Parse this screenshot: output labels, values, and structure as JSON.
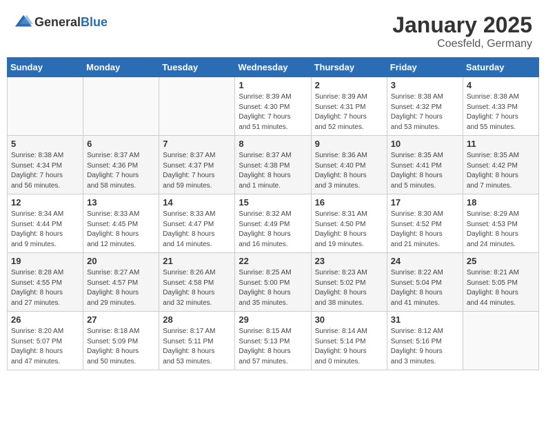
{
  "header": {
    "logo_general": "General",
    "logo_blue": "Blue",
    "title": "January 2025",
    "subtitle": "Coesfeld, Germany"
  },
  "weekdays": [
    "Sunday",
    "Monday",
    "Tuesday",
    "Wednesday",
    "Thursday",
    "Friday",
    "Saturday"
  ],
  "weeks": [
    [
      {
        "day": "",
        "info": ""
      },
      {
        "day": "",
        "info": ""
      },
      {
        "day": "",
        "info": ""
      },
      {
        "day": "1",
        "info": "Sunrise: 8:39 AM\nSunset: 4:30 PM\nDaylight: 7 hours\nand 51 minutes."
      },
      {
        "day": "2",
        "info": "Sunrise: 8:39 AM\nSunset: 4:31 PM\nDaylight: 7 hours\nand 52 minutes."
      },
      {
        "day": "3",
        "info": "Sunrise: 8:38 AM\nSunset: 4:32 PM\nDaylight: 7 hours\nand 53 minutes."
      },
      {
        "day": "4",
        "info": "Sunrise: 8:38 AM\nSunset: 4:33 PM\nDaylight: 7 hours\nand 55 minutes."
      }
    ],
    [
      {
        "day": "5",
        "info": "Sunrise: 8:38 AM\nSunset: 4:34 PM\nDaylight: 7 hours\nand 56 minutes."
      },
      {
        "day": "6",
        "info": "Sunrise: 8:37 AM\nSunset: 4:36 PM\nDaylight: 7 hours\nand 58 minutes."
      },
      {
        "day": "7",
        "info": "Sunrise: 8:37 AM\nSunset: 4:37 PM\nDaylight: 7 hours\nand 59 minutes."
      },
      {
        "day": "8",
        "info": "Sunrise: 8:37 AM\nSunset: 4:38 PM\nDaylight: 8 hours\nand 1 minute."
      },
      {
        "day": "9",
        "info": "Sunrise: 8:36 AM\nSunset: 4:40 PM\nDaylight: 8 hours\nand 3 minutes."
      },
      {
        "day": "10",
        "info": "Sunrise: 8:35 AM\nSunset: 4:41 PM\nDaylight: 8 hours\nand 5 minutes."
      },
      {
        "day": "11",
        "info": "Sunrise: 8:35 AM\nSunset: 4:42 PM\nDaylight: 8 hours\nand 7 minutes."
      }
    ],
    [
      {
        "day": "12",
        "info": "Sunrise: 8:34 AM\nSunset: 4:44 PM\nDaylight: 8 hours\nand 9 minutes."
      },
      {
        "day": "13",
        "info": "Sunrise: 8:33 AM\nSunset: 4:45 PM\nDaylight: 8 hours\nand 12 minutes."
      },
      {
        "day": "14",
        "info": "Sunrise: 8:33 AM\nSunset: 4:47 PM\nDaylight: 8 hours\nand 14 minutes."
      },
      {
        "day": "15",
        "info": "Sunrise: 8:32 AM\nSunset: 4:49 PM\nDaylight: 8 hours\nand 16 minutes."
      },
      {
        "day": "16",
        "info": "Sunrise: 8:31 AM\nSunset: 4:50 PM\nDaylight: 8 hours\nand 19 minutes."
      },
      {
        "day": "17",
        "info": "Sunrise: 8:30 AM\nSunset: 4:52 PM\nDaylight: 8 hours\nand 21 minutes."
      },
      {
        "day": "18",
        "info": "Sunrise: 8:29 AM\nSunset: 4:53 PM\nDaylight: 8 hours\nand 24 minutes."
      }
    ],
    [
      {
        "day": "19",
        "info": "Sunrise: 8:28 AM\nSunset: 4:55 PM\nDaylight: 8 hours\nand 27 minutes."
      },
      {
        "day": "20",
        "info": "Sunrise: 8:27 AM\nSunset: 4:57 PM\nDaylight: 8 hours\nand 29 minutes."
      },
      {
        "day": "21",
        "info": "Sunrise: 8:26 AM\nSunset: 4:58 PM\nDaylight: 8 hours\nand 32 minutes."
      },
      {
        "day": "22",
        "info": "Sunrise: 8:25 AM\nSunset: 5:00 PM\nDaylight: 8 hours\nand 35 minutes."
      },
      {
        "day": "23",
        "info": "Sunrise: 8:23 AM\nSunset: 5:02 PM\nDaylight: 8 hours\nand 38 minutes."
      },
      {
        "day": "24",
        "info": "Sunrise: 8:22 AM\nSunset: 5:04 PM\nDaylight: 8 hours\nand 41 minutes."
      },
      {
        "day": "25",
        "info": "Sunrise: 8:21 AM\nSunset: 5:05 PM\nDaylight: 8 hours\nand 44 minutes."
      }
    ],
    [
      {
        "day": "26",
        "info": "Sunrise: 8:20 AM\nSunset: 5:07 PM\nDaylight: 8 hours\nand 47 minutes."
      },
      {
        "day": "27",
        "info": "Sunrise: 8:18 AM\nSunset: 5:09 PM\nDaylight: 8 hours\nand 50 minutes."
      },
      {
        "day": "28",
        "info": "Sunrise: 8:17 AM\nSunset: 5:11 PM\nDaylight: 8 hours\nand 53 minutes."
      },
      {
        "day": "29",
        "info": "Sunrise: 8:15 AM\nSunset: 5:13 PM\nDaylight: 8 hours\nand 57 minutes."
      },
      {
        "day": "30",
        "info": "Sunrise: 8:14 AM\nSunset: 5:14 PM\nDaylight: 9 hours\nand 0 minutes."
      },
      {
        "day": "31",
        "info": "Sunrise: 8:12 AM\nSunset: 5:16 PM\nDaylight: 9 hours\nand 3 minutes."
      },
      {
        "day": "",
        "info": ""
      }
    ]
  ]
}
